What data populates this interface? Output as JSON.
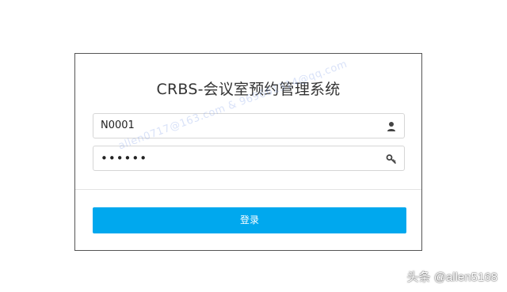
{
  "login": {
    "title": "CRBS-会议室预约管理系统",
    "username_value": "N0001",
    "password_value": "••••••",
    "username_icon": "user-icon",
    "password_icon": "key-icon",
    "submit_label": "登录"
  },
  "watermark_text": "allen0717@163.com & 969661314@qq.com",
  "attribution_text": "头条 @allen5168",
  "colors": {
    "accent": "#00a8ee",
    "border": "#d6d6d6",
    "card_border": "#555555"
  }
}
